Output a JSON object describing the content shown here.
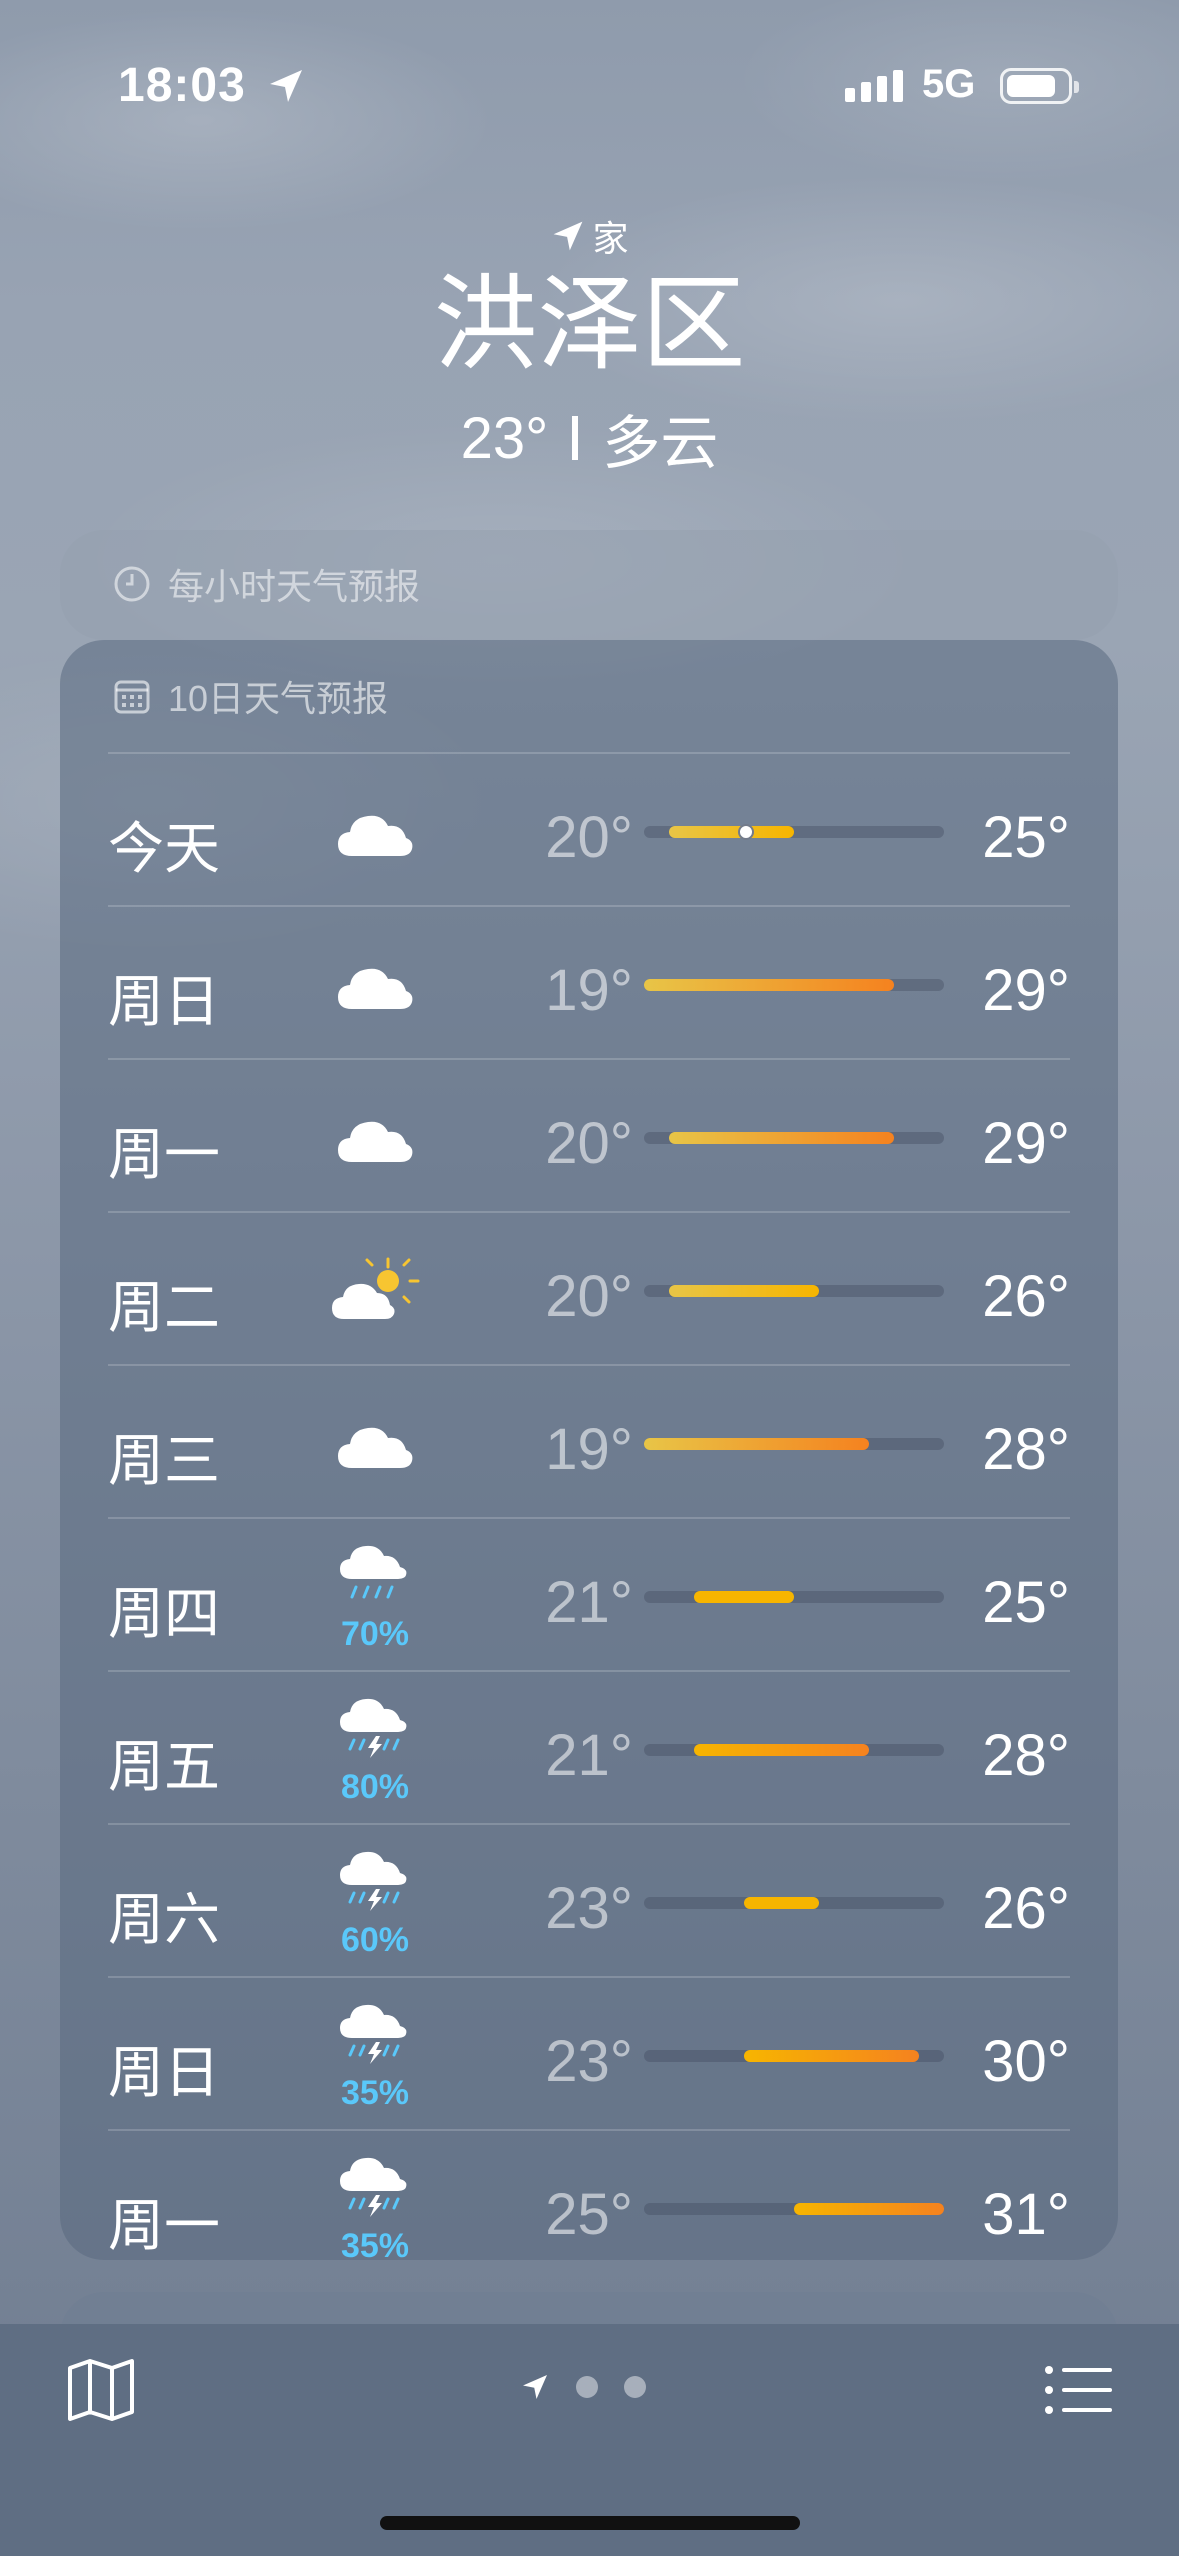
{
  "status_bar": {
    "time": "18:03",
    "network": "5G"
  },
  "location": {
    "tag": "家",
    "city": "洪泽区",
    "temp": "23°",
    "condition": "多云"
  },
  "hourly_section": {
    "title": "每小时天气预报",
    "icon": "clock-icon"
  },
  "forecast": {
    "title": "10日天气预报",
    "icon": "calendar-icon",
    "scale": {
      "min": 19,
      "max": 31
    },
    "days": [
      {
        "day": "今天",
        "icon": "cloud-icon",
        "precip": "",
        "low": "20°",
        "high": "25°",
        "lo_v": 20,
        "hi_v": 25,
        "current": 23
      },
      {
        "day": "周日",
        "icon": "cloud-icon",
        "precip": "",
        "low": "19°",
        "high": "29°",
        "lo_v": 19,
        "hi_v": 29
      },
      {
        "day": "周一",
        "icon": "cloud-icon",
        "precip": "",
        "low": "20°",
        "high": "29°",
        "lo_v": 20,
        "hi_v": 29
      },
      {
        "day": "周二",
        "icon": "partly-sunny-icon",
        "precip": "",
        "low": "20°",
        "high": "26°",
        "lo_v": 20,
        "hi_v": 26
      },
      {
        "day": "周三",
        "icon": "cloud-icon",
        "precip": "",
        "low": "19°",
        "high": "28°",
        "lo_v": 19,
        "hi_v": 28
      },
      {
        "day": "周四",
        "icon": "rain-icon",
        "precip": "70%",
        "low": "21°",
        "high": "25°",
        "lo_v": 21,
        "hi_v": 25
      },
      {
        "day": "周五",
        "icon": "thunderstorm-icon",
        "precip": "80%",
        "low": "21°",
        "high": "28°",
        "lo_v": 21,
        "hi_v": 28
      },
      {
        "day": "周六",
        "icon": "thunderstorm-icon",
        "precip": "60%",
        "low": "23°",
        "high": "26°",
        "lo_v": 23,
        "hi_v": 26
      },
      {
        "day": "周日",
        "icon": "thunderstorm-icon",
        "precip": "35%",
        "low": "23°",
        "high": "30°",
        "lo_v": 23,
        "hi_v": 30
      },
      {
        "day": "周一",
        "icon": "thunderstorm-icon",
        "precip": "35%",
        "low": "25°",
        "high": "31°",
        "lo_v": 25,
        "hi_v": 31
      }
    ]
  },
  "tab_bar": {
    "page_count": 3,
    "active_page": 0
  },
  "colors": {
    "precip": "#5ac8fa",
    "bar_cool": "#e8c547",
    "bar_warm": "#f7b500",
    "bar_hot": "#f5821f"
  }
}
